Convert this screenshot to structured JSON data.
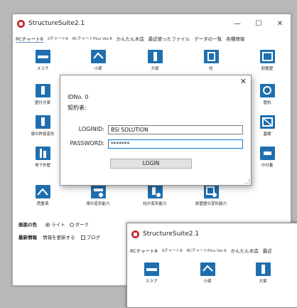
{
  "main_window": {
    "title": "StructureSuite2.1",
    "controls": [
      "—",
      "☐",
      "✕"
    ],
    "menu": [
      "RCチャート8",
      "Sチャート8",
      "RCチャートPlus Ver.8",
      "かんたん木造",
      "最近使ったファイル",
      "データの一覧",
      "各種情報"
    ],
    "icons": [
      {
        "label": "スラブ",
        "icon": "slab-icon"
      },
      {
        "label": "小梁",
        "icon": "small-beam-icon"
      },
      {
        "label": "大梁",
        "icon": "large-beam-icon"
      },
      {
        "label": "柱",
        "icon": "column-icon"
      },
      {
        "label": "耐震壁",
        "icon": "shear-wall-icon"
      },
      {
        "label": "壁付き梁",
        "icon": "wall-beam-icon"
      },
      {
        "label": "管杭",
        "icon": "pile-icon"
      },
      {
        "label": "梁の許容変形",
        "icon": "beam-deformation-icon"
      },
      {
        "label": "基礎",
        "icon": "foundation-icon"
      },
      {
        "label": "地下外壁",
        "icon": "basement-wall-icon"
      },
      {
        "label": "の付着",
        "icon": "bond-icon"
      },
      {
        "label": "荷重項",
        "icon": "load-term-icon"
      },
      {
        "label": "梁の変形能力",
        "icon": "beam-capacity-icon"
      },
      {
        "label": "柱の変形能力",
        "icon": "column-capacity-icon"
      },
      {
        "label": "耐震壁の変形能力",
        "icon": "wall-capacity-icon"
      }
    ],
    "bottom": {
      "color_label": "画面の色",
      "color_light": "ライト",
      "color_dark": "ダーク",
      "latest_label": "最新情報",
      "update_label": "情報を更新する",
      "blog_label": "ブログ"
    }
  },
  "login_dialog": {
    "close": "✕",
    "id_no": "IDNo. 0",
    "contractor": "契約者:",
    "loginid_label": "LOGINID:",
    "loginid_value": "BSI SOLUTION",
    "password_label": "PASSWORD:",
    "password_value": "*******",
    "login_button": "LOGIN"
  },
  "second_window": {
    "title": "StructureSuite2.1",
    "menu": [
      "RCチャート8",
      "Sチャート8",
      "RCチャートPlus Ver.8",
      "かんたん木造",
      "最近"
    ],
    "icons": [
      {
        "label": "スラブ",
        "icon": "slab-icon"
      },
      {
        "label": "小梁",
        "icon": "small-beam-icon"
      },
      {
        "label": "大梁",
        "icon": "large-beam-icon"
      }
    ]
  }
}
